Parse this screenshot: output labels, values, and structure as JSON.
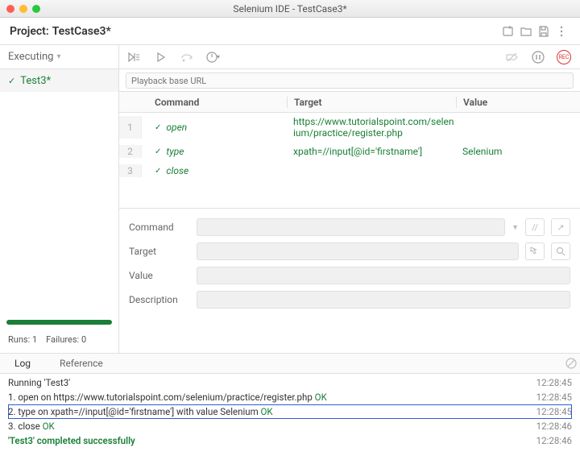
{
  "window": {
    "title": "Selenium IDE - TestCase3*"
  },
  "project": {
    "label": "Project:",
    "name": "TestCase3*"
  },
  "sidebar": {
    "executing_label": "Executing",
    "test_name": "Test3*",
    "runs_label": "Runs:",
    "runs_value": "1",
    "failures_label": "Failures:",
    "failures_value": "0"
  },
  "url_placeholder": "Playback base URL",
  "headers": {
    "command": "Command",
    "target": "Target",
    "value": "Value"
  },
  "steps": [
    {
      "n": "1",
      "cmd": "open",
      "tgt": "https://www.tutorialspoint.com/selenium/practice/register.php",
      "val": ""
    },
    {
      "n": "2",
      "cmd": "type",
      "tgt": "xpath=//input[@id='firstname']",
      "val": "Selenium"
    },
    {
      "n": "3",
      "cmd": "close",
      "tgt": "",
      "val": ""
    }
  ],
  "editor": {
    "command_label": "Command",
    "target_label": "Target",
    "value_label": "Value",
    "description_label": "Description"
  },
  "tabs": {
    "log": "Log",
    "reference": "Reference"
  },
  "log": [
    {
      "msg": "Running 'Test3'",
      "time": "12:28:45",
      "cls": ""
    },
    {
      "msg": "1. open on https://www.tutorialspoint.com/selenium/practice/register.php ",
      "ok": "OK",
      "time": "12:28:45",
      "cls": ""
    },
    {
      "msg": "2. type on xpath=//input[@id='firstname'] with value Selenium ",
      "ok": "OK",
      "time": "12:28:45",
      "cls": "highlight"
    },
    {
      "msg": "3. close ",
      "ok": "OK",
      "time": "12:28:46",
      "cls": ""
    },
    {
      "msg": "'Test3' completed successfully",
      "time": "12:28:46",
      "cls": "success"
    }
  ]
}
